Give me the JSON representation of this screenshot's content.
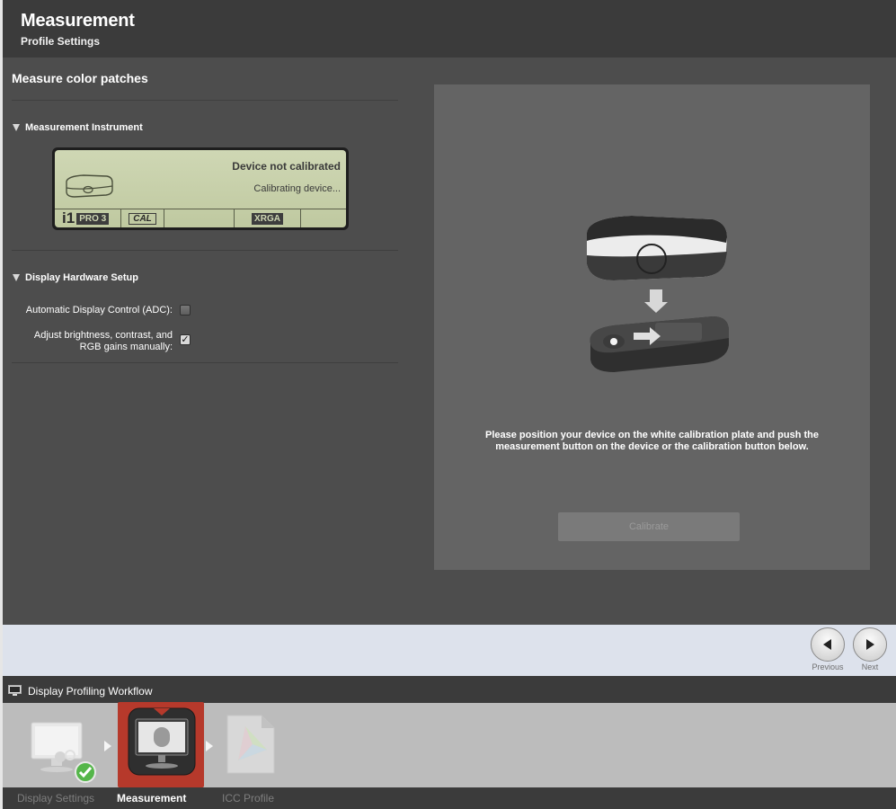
{
  "header": {
    "title": "Measurement",
    "subtitle": "Profile Settings"
  },
  "left": {
    "section_title": "Measure color patches",
    "instrument": {
      "heading": "Measurement Instrument",
      "lcd_status": "Device not calibrated",
      "lcd_sub": "Calibrating device...",
      "lcd_brand": "i1",
      "lcd_model": "PRO 3",
      "lcd_mode": "CAL",
      "lcd_extra": "XRGA"
    },
    "hardware": {
      "heading": "Display Hardware Setup",
      "adc_label": "Automatic Display Control (ADC):",
      "adc_checked": false,
      "manual_label_1": "Adjust brightness, contrast, and",
      "manual_label_2": "RGB gains manually:",
      "manual_checked": true
    }
  },
  "panel": {
    "instruction_1": "Please position your device on the white calibration plate and push the",
    "instruction_2": "measurement button on the device or the calibration button below.",
    "calibrate_label": "Calibrate"
  },
  "nav": {
    "previous_label": "Previous",
    "next_label": "Next"
  },
  "workflow": {
    "title": "Display Profiling Workflow",
    "steps": [
      {
        "label": "Display Settings",
        "state": "done"
      },
      {
        "label": "Measurement",
        "state": "active"
      },
      {
        "label": "ICC Profile",
        "state": "pending"
      }
    ]
  },
  "colors": {
    "accent_active": "#b6392b",
    "header_bg": "#3b3b3b",
    "main_bg": "#4d4d4d",
    "lcd_bg": "#c7d0aa",
    "check_green": "#55b64a"
  }
}
